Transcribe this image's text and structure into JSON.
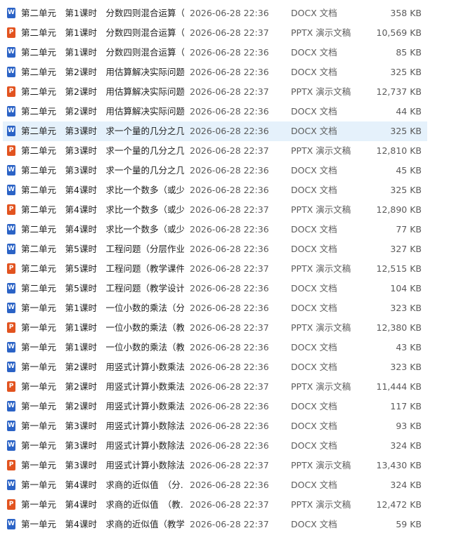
{
  "colors": {
    "docx_icon": "#2b63c6",
    "pptx_icon": "#e2531f",
    "selection": "#e5f1fb"
  },
  "files": [
    {
      "name": "第二单元　第1课时　分数四则混合运算（...",
      "date": "2026-06-28 22:36",
      "type": "DOCX 文档",
      "size": "358 KB",
      "icon": "word-icon",
      "glyph": "W",
      "kind": "docx"
    },
    {
      "name": "第二单元　第1课时　分数四则混合运算（...",
      "date": "2026-06-28 22:37",
      "type": "PPTX 演示文稿",
      "size": "10,569 KB",
      "icon": "powerpoint-icon",
      "glyph": "P",
      "kind": "pptx"
    },
    {
      "name": "第二单元　第1课时　分数四则混合运算（...",
      "date": "2026-06-28 22:36",
      "type": "DOCX 文档",
      "size": "85 KB",
      "icon": "word-icon",
      "glyph": "W",
      "kind": "docx"
    },
    {
      "name": "第二单元　第2课时　用估算解决实际问题...",
      "date": "2026-06-28 22:36",
      "type": "DOCX 文档",
      "size": "325 KB",
      "icon": "word-icon",
      "glyph": "W",
      "kind": "docx"
    },
    {
      "name": "第二单元　第2课时　用估算解决实际问题...",
      "date": "2026-06-28 22:37",
      "type": "PPTX 演示文稿",
      "size": "12,737 KB",
      "icon": "powerpoint-icon",
      "glyph": "P",
      "kind": "pptx"
    },
    {
      "name": "第二单元　第2课时　用估算解决实际问题...",
      "date": "2026-06-28 22:36",
      "type": "DOCX 文档",
      "size": "44 KB",
      "icon": "word-icon",
      "glyph": "W",
      "kind": "docx"
    },
    {
      "name": "第二单元　第3课时　求一个量的几分之几...",
      "date": "2026-06-28 22:36",
      "type": "DOCX 文档",
      "size": "325 KB",
      "icon": "word-icon",
      "glyph": "W",
      "kind": "docx",
      "selected": true
    },
    {
      "name": "第二单元　第3课时　求一个量的几分之几...",
      "date": "2026-06-28 22:37",
      "type": "PPTX 演示文稿",
      "size": "12,810 KB",
      "icon": "powerpoint-icon",
      "glyph": "P",
      "kind": "pptx"
    },
    {
      "name": "第二单元　第3课时　求一个量的几分之几...",
      "date": "2026-06-28 22:36",
      "type": "DOCX 文档",
      "size": "45 KB",
      "icon": "word-icon",
      "glyph": "W",
      "kind": "docx"
    },
    {
      "name": "第二单元　第4课时　求比一个数多（或少...",
      "date": "2026-06-28 22:36",
      "type": "DOCX 文档",
      "size": "325 KB",
      "icon": "word-icon",
      "glyph": "W",
      "kind": "docx"
    },
    {
      "name": "第二单元　第4课时　求比一个数多（或少...",
      "date": "2026-06-28 22:37",
      "type": "PPTX 演示文稿",
      "size": "12,890 KB",
      "icon": "powerpoint-icon",
      "glyph": "P",
      "kind": "pptx"
    },
    {
      "name": "第二单元　第4课时　求比一个数多（或少...",
      "date": "2026-06-28 22:36",
      "type": "DOCX 文档",
      "size": "77 KB",
      "icon": "word-icon",
      "glyph": "W",
      "kind": "docx"
    },
    {
      "name": "第二单元　第5课时　工程问题（分层作业...",
      "date": "2026-06-28 22:36",
      "type": "DOCX 文档",
      "size": "327 KB",
      "icon": "word-icon",
      "glyph": "W",
      "kind": "docx"
    },
    {
      "name": "第二单元　第5课时　工程问题（教学课件...",
      "date": "2026-06-28 22:37",
      "type": "PPTX 演示文稿",
      "size": "12,515 KB",
      "icon": "powerpoint-icon",
      "glyph": "P",
      "kind": "pptx"
    },
    {
      "name": "第二单元　第5课时　工程问题（教学设计...",
      "date": "2026-06-28 22:36",
      "type": "DOCX 文档",
      "size": "104 KB",
      "icon": "word-icon",
      "glyph": "W",
      "kind": "docx"
    },
    {
      "name": "第一单元　第1课时　一位小数的乘法（分...",
      "date": "2026-06-28 22:36",
      "type": "DOCX 文档",
      "size": "323 KB",
      "icon": "word-icon",
      "glyph": "W",
      "kind": "docx"
    },
    {
      "name": "第一单元　第1课时　一位小数的乘法（教...",
      "date": "2026-06-28 22:37",
      "type": "PPTX 演示文稿",
      "size": "12,380 KB",
      "icon": "powerpoint-icon",
      "glyph": "P",
      "kind": "pptx"
    },
    {
      "name": "第一单元　第1课时　一位小数的乘法（教...",
      "date": "2026-06-28 22:36",
      "type": "DOCX 文档",
      "size": "43 KB",
      "icon": "word-icon",
      "glyph": "W",
      "kind": "docx"
    },
    {
      "name": "第一单元　第2课时　用竖式计算小数乘法...",
      "date": "2026-06-28 22:36",
      "type": "DOCX 文档",
      "size": "323 KB",
      "icon": "word-icon",
      "glyph": "W",
      "kind": "docx"
    },
    {
      "name": "第一单元　第2课时　用竖式计算小数乘法...",
      "date": "2026-06-28 22:37",
      "type": "PPTX 演示文稿",
      "size": "11,444 KB",
      "icon": "powerpoint-icon",
      "glyph": "P",
      "kind": "pptx"
    },
    {
      "name": "第一单元　第2课时　用竖式计算小数乘法...",
      "date": "2026-06-28 22:36",
      "type": "DOCX 文档",
      "size": "117 KB",
      "icon": "word-icon",
      "glyph": "W",
      "kind": "docx"
    },
    {
      "name": "第一单元　第3课时　用竖式计算小数除法...",
      "date": "2026-06-28 22:36",
      "type": "DOCX 文档",
      "size": "93 KB",
      "icon": "word-icon",
      "glyph": "W",
      "kind": "docx"
    },
    {
      "name": "第一单元　第3课时　用竖式计算小数除法...",
      "date": "2026-06-28 22:36",
      "type": "DOCX 文档",
      "size": "324 KB",
      "icon": "word-icon",
      "glyph": "W",
      "kind": "docx"
    },
    {
      "name": "第一单元　第3课时　用竖式计算小数除法...",
      "date": "2026-06-28 22:37",
      "type": "PPTX 演示文稿",
      "size": "13,430 KB",
      "icon": "powerpoint-icon",
      "glyph": "P",
      "kind": "pptx"
    },
    {
      "name": "第一单元　第4课时　求商的近似值　（分...",
      "date": "2026-06-28 22:36",
      "type": "DOCX 文档",
      "size": "324 KB",
      "icon": "word-icon",
      "glyph": "W",
      "kind": "docx"
    },
    {
      "name": "第一单元　第4课时　求商的近似值　（教...",
      "date": "2026-06-28 22:37",
      "type": "PPTX 演示文稿",
      "size": "12,472 KB",
      "icon": "powerpoint-icon",
      "glyph": "P",
      "kind": "pptx"
    },
    {
      "name": "第一单元　第4课时　求商的近似值（教学...",
      "date": "2026-06-28 22:37",
      "type": "DOCX 文档",
      "size": "59 KB",
      "icon": "word-icon",
      "glyph": "W",
      "kind": "docx"
    }
  ]
}
